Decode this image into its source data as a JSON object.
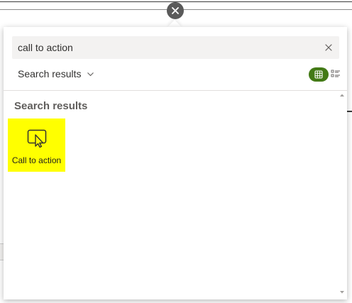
{
  "search": {
    "value": "call to action",
    "clear_icon": "dismiss-icon"
  },
  "filter": {
    "label": "Search results",
    "icon": "chevron-down-icon"
  },
  "view_toggle": {
    "grid_icon": "grid-view-icon",
    "list_icon": "list-view-icon",
    "active_color": "#437a16"
  },
  "results": {
    "heading": "Search results",
    "items": [
      {
        "label": "Call to action",
        "icon": "cursor-click-icon",
        "highlight": "#ffff00"
      }
    ]
  },
  "close": {
    "icon": "close-icon"
  }
}
